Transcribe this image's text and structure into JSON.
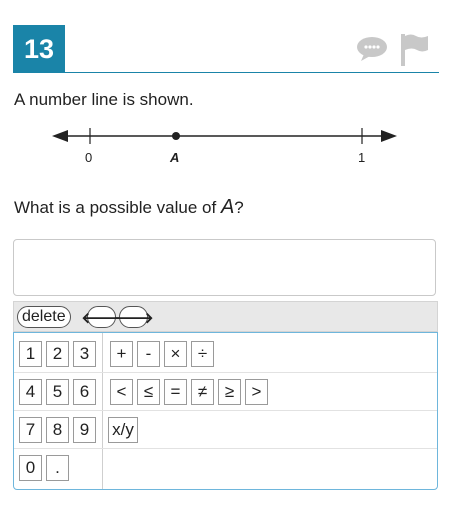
{
  "header": {
    "question_number": "13"
  },
  "icons": {
    "comment": "speech-bubble-icon",
    "flag": "flag-icon"
  },
  "prompt_text": "A number line is shown.",
  "number_line": {
    "left_label": "0",
    "point_label": "A",
    "right_label": "1"
  },
  "question": {
    "before": "What is a possible value of ",
    "variable": "A",
    "after": "?"
  },
  "answer_box": {
    "value": ""
  },
  "toolbar": {
    "delete_label": "delete",
    "left_arrow": "🡐",
    "right_arrow": "🡒"
  },
  "keypad": {
    "digits": [
      "1",
      "2",
      "3",
      "4",
      "5",
      "6",
      "7",
      "8",
      "9",
      "0",
      "."
    ],
    "operators": [
      "+",
      "-",
      "×",
      "÷"
    ],
    "comparisons": [
      "<",
      "≤",
      "=",
      "≠",
      "≥",
      ">"
    ],
    "fraction": "x/y"
  }
}
